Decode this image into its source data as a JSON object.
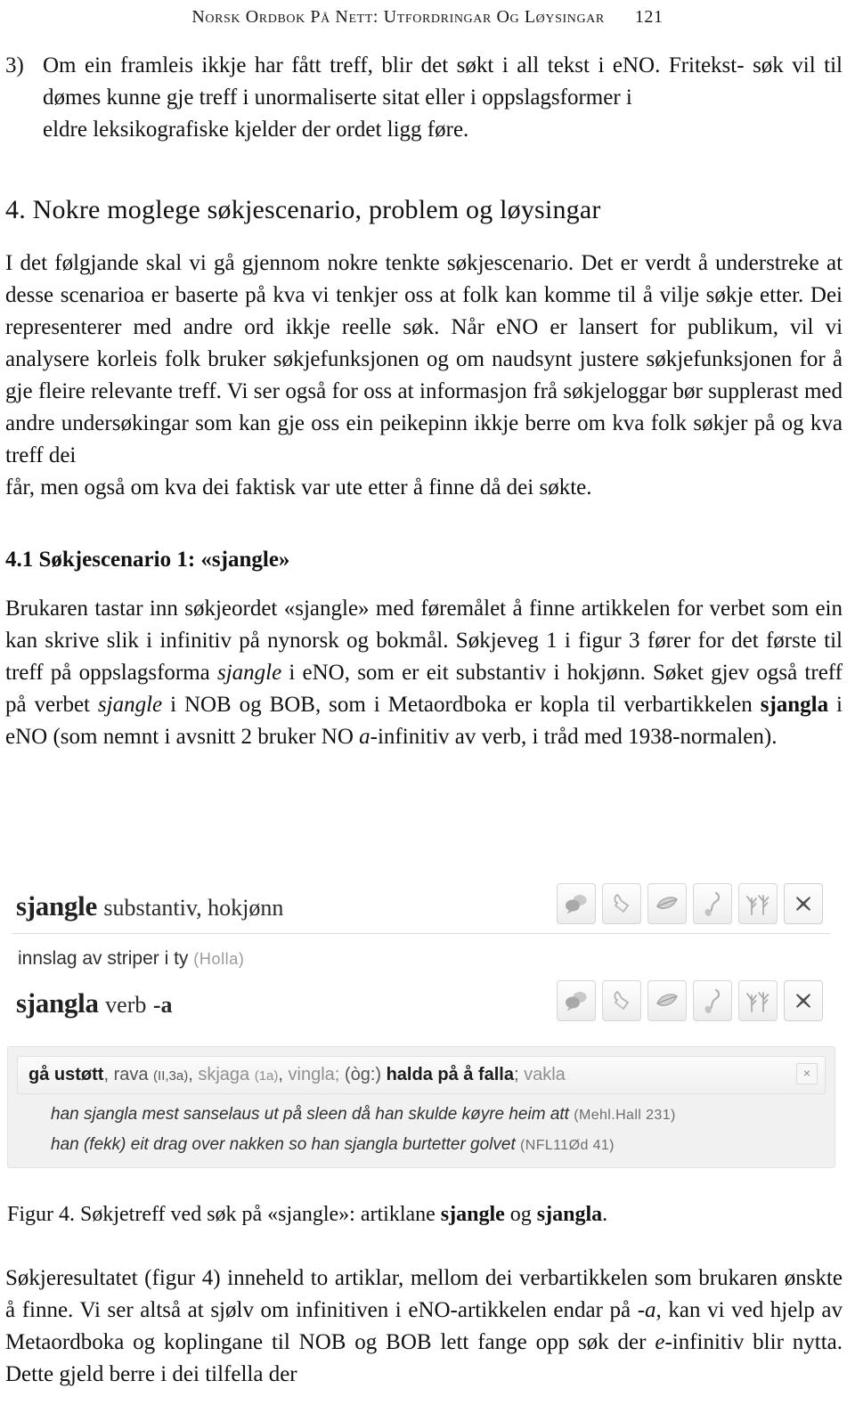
{
  "running_head": {
    "title": "Norsk Ordbok på nett: Utfordringar og løysingar",
    "folio": "121"
  },
  "list_item": {
    "marker": "3)",
    "line1": "Om ein framleis ikkje har fått treff, blir det søkt i all tekst i eNO. Fritekst-",
    "line2": "søk vil til dømes kunne gje treff i unormaliserte sitat eller i oppslagsformer i",
    "line3": "eldre leksikografiske kjelder der ordet ligg føre."
  },
  "section": {
    "heading": "4. Nokre moglege søkjescenario, problem og løysingar",
    "paragraph": {
      "line1": "I det følgjande skal vi gå gjennom nokre tenkte søkjescenario. Det er verdt å",
      "line2": "understreke at desse scenarioa er baserte på kva vi tenkjer oss at folk kan komme",
      "line3": "til å vilje søkje etter. Dei representerer med andre ord ikkje reelle søk. Når eNO",
      "line4": "er lansert for publikum, vil vi analysere korleis folk bruker søkjefunksjonen og",
      "line5": "om naudsynt justere søkjefunksjonen for å gje fleire relevante treff. Vi ser også",
      "line6": "for oss at informasjon frå søkjeloggar bør supplerast med andre undersøkingar",
      "line7": "som kan gje oss ein peikepinn ikkje berre om kva folk søkjer på og kva treff dei",
      "line8": "får, men også om kva dei faktisk var ute etter å finne då dei søkte."
    }
  },
  "subsection": {
    "heading": "4.1 Søkjescenario 1: «sjangle»",
    "paragraph": {
      "seg1": "Brukaren tastar inn søkjeordet «sjangle» med føremålet å finne artikkelen for verbet som ein kan skrive slik i infinitiv på nynorsk og bokmål. Søkjeveg 1 i figur 3 fører for det første til treff på oppslagsforma ",
      "em1": "sjangle",
      "seg2": " i eNO, som er eit substantiv i hokjønn. Søket gjev også treff på verbet ",
      "em2": "sjangle",
      "seg3": " i NOB og BOB, som i Metaordboka er kopla til verbartikkelen ",
      "strong1": "sjangla",
      "seg4": " i eNO (som nemnt i avsnitt 2 bruker NO ",
      "em3": "a",
      "seg5": "-infinitiv av verb, i tråd med 1938-normalen)."
    }
  },
  "figure": {
    "entry1": {
      "lemma": "sjangle",
      "grammar": "substantiv, hokjønn",
      "toolbar": [
        {
          "name": "speech-bubbles-icon",
          "label": "kommentar"
        },
        {
          "name": "stamp-icon",
          "label": "stempel"
        },
        {
          "name": "leaf-icon",
          "label": "blad"
        },
        {
          "name": "spoon-icon",
          "label": "skei"
        },
        {
          "name": "branches-icon",
          "label": "greiner"
        },
        {
          "name": "close-icon",
          "label": "lukk"
        }
      ]
    },
    "subline": {
      "text": "innslag av striper i ty",
      "source": "(Holla)"
    },
    "entry2": {
      "lemma": "sjangla",
      "grammar": "verb",
      "inflection": "-a",
      "toolbar": [
        {
          "name": "speech-bubbles-icon",
          "label": "kommentar"
        },
        {
          "name": "stamp-icon",
          "label": "stempel"
        },
        {
          "name": "leaf-icon",
          "label": "blad"
        },
        {
          "name": "spoon-icon",
          "label": "skei"
        },
        {
          "name": "branches-icon",
          "label": "greiner"
        },
        {
          "name": "close-icon",
          "label": "lukk"
        }
      ]
    },
    "definition": {
      "parts": [
        {
          "text": "gå ustøtt",
          "style": "strong"
        },
        {
          "text": ", ",
          "style": "mid"
        },
        {
          "text": "rava ",
          "style": "mid"
        },
        {
          "text": "(II,3a)",
          "style": "tiny-mid"
        },
        {
          "text": ", ",
          "style": "mid"
        },
        {
          "text": "skjaga ",
          "style": "dim"
        },
        {
          "text": "(1a)",
          "style": "tiny-dim"
        },
        {
          "text": ", ",
          "style": "mid"
        },
        {
          "text": "vingla; ",
          "style": "dim"
        },
        {
          "text": "(òg:) ",
          "style": "mid"
        },
        {
          "text": "halda på å falla",
          "style": "strong"
        },
        {
          "text": "; ",
          "style": "mid"
        },
        {
          "text": "vakla",
          "style": "dim"
        }
      ],
      "close_label": "×"
    },
    "quotes": [
      {
        "text": "han sjangla mest sanselaus ut på sleen då han skulde køyre heim att",
        "ref": "(Mehl.Hall 231)"
      },
      {
        "text": "han (fekk) eit drag over nakken so han sjangla burtetter golvet",
        "ref": "(NFL11Ød 41)"
      }
    ]
  },
  "caption": {
    "seg1": "Figur 4. Søkjetreff ved søk på «sjangle»: artiklane ",
    "strong1": "sjangle",
    "seg2": " og ",
    "strong2": "sjangla",
    "seg3": "."
  },
  "tail_paragraph": {
    "seg1": "Søkjeresultatet (figur 4) inneheld to artiklar, mellom dei verbartikkelen som brukaren ønskte å finne. Vi ser altså at sjølv om infinitiven i eNO-artikkelen endar på -",
    "em1": "a",
    "seg2": ", kan vi ved hjelp av Metaordboka og koplingane til NOB og BOB lett fange opp søk der ",
    "em2": "e",
    "seg3": "-infinitiv blir nytta. Dette gjeld berre i dei tilfella der"
  },
  "colors": {
    "page_background": "#ffffff",
    "text": "#111111",
    "figure_panel": "#f1f1f1",
    "figure_border": "#e2e2e2",
    "muted_text": "#8f8f8f"
  }
}
